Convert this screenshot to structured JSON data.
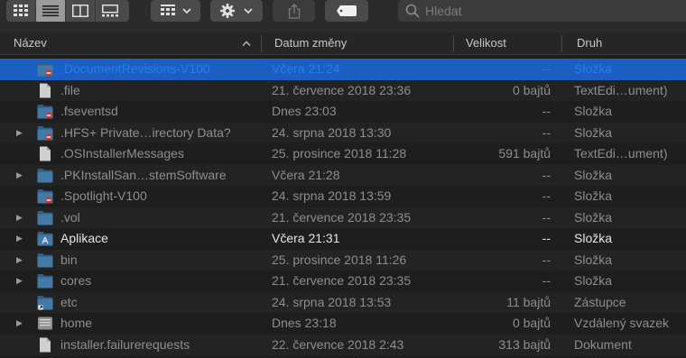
{
  "toolbar": {
    "views": [
      {
        "icon": "icon-view-icon",
        "active": false
      },
      {
        "icon": "list-view-icon",
        "active": true
      },
      {
        "icon": "column-view-icon",
        "active": false
      },
      {
        "icon": "gallery-view-icon",
        "active": false
      }
    ],
    "group_icon": "group-by-icon",
    "action_icon": "gear-icon",
    "share_icon": "share-icon",
    "tag_icon": "tag-icon",
    "search_placeholder": "Hledat"
  },
  "columns": {
    "name": "Název",
    "date": "Datum změny",
    "size": "Velikost",
    "kind": "Druh"
  },
  "files": [
    {
      "name": ".DocumentRevisions-V100",
      "date": "Včera 21:24",
      "size": "--",
      "kind": "Složka",
      "icon": "restricted-folder-icon",
      "disclosure": false,
      "selected": true
    },
    {
      "name": ".file",
      "date": "21. července 2018 23:36",
      "size": "0 bajtů",
      "kind": "TextEdi…ument)",
      "icon": "document-icon",
      "disclosure": false
    },
    {
      "name": ".fseventsd",
      "date": "Dnes 23:03",
      "size": "--",
      "kind": "Složka",
      "icon": "restricted-folder-icon",
      "disclosure": false
    },
    {
      "name": ".HFS+ Private…irectory Data?",
      "date": "24. srpna 2018 13:30",
      "size": "--",
      "kind": "Složka",
      "icon": "restricted-folder-icon",
      "disclosure": true
    },
    {
      "name": ".OSInstallerMessages",
      "date": "25. prosince 2018 11:28",
      "size": "591 bajtů",
      "kind": "TextEdi…ument)",
      "icon": "document-icon",
      "disclosure": false
    },
    {
      "name": ".PKInstallSan…stemSoftware",
      "date": "Včera 21:28",
      "size": "--",
      "kind": "Složka",
      "icon": "folder-icon",
      "disclosure": true
    },
    {
      "name": ".Spotlight-V100",
      "date": "24. srpna 2018 13:59",
      "size": "--",
      "kind": "Složka",
      "icon": "restricted-folder-icon",
      "disclosure": false
    },
    {
      "name": ".vol",
      "date": "21. července 2018 23:35",
      "size": "--",
      "kind": "Složka",
      "icon": "folder-icon",
      "disclosure": true
    },
    {
      "name": "Aplikace",
      "date": "Včera 21:31",
      "size": "--",
      "kind": "Složka",
      "icon": "applications-folder-icon",
      "disclosure": true,
      "bright": true
    },
    {
      "name": "bin",
      "date": "25. prosince 2018 11:26",
      "size": "--",
      "kind": "Složka",
      "icon": "folder-icon",
      "disclosure": true
    },
    {
      "name": "cores",
      "date": "21. července 2018 23:35",
      "size": "--",
      "kind": "Složka",
      "icon": "folder-icon",
      "disclosure": true
    },
    {
      "name": "etc",
      "date": "24. srpna 2018 13:53",
      "size": "11 bajtů",
      "kind": "Zástupce",
      "icon": "alias-folder-icon",
      "disclosure": false
    },
    {
      "name": "home",
      "date": "Dnes 23:18",
      "size": "0 bajtů",
      "kind": "Vzdálený svazek",
      "icon": "network-volume-icon",
      "disclosure": true
    },
    {
      "name": "installer.failurerequests",
      "date": "22. července 2018 2:43",
      "size": "313 bajtů",
      "kind": "Dokument",
      "icon": "document-icon",
      "disclosure": false
    }
  ],
  "colors": {
    "background": "#1e1e1e",
    "selection": "#1a5fc2",
    "folder": "#3d6f96"
  }
}
